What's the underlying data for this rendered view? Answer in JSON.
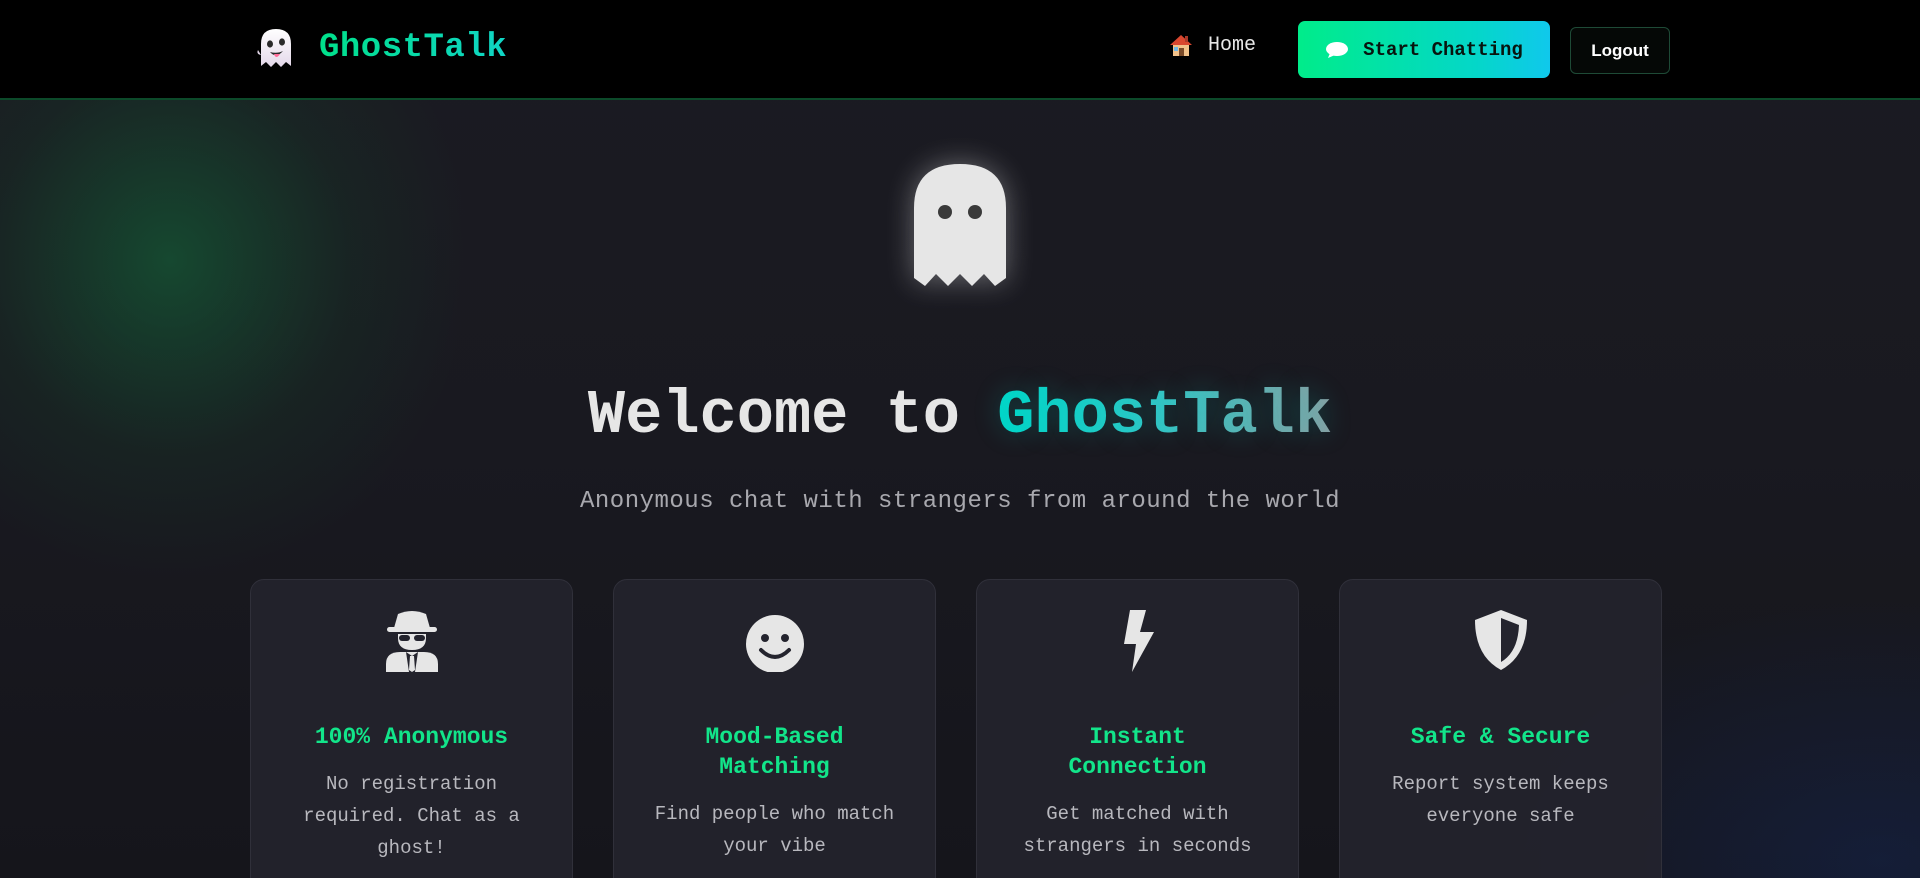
{
  "navbar": {
    "brand_name": "GhostTalk",
    "brand_icon": "ghost-emoji-icon",
    "home_label": "Home",
    "home_icon": "house-icon",
    "start_label": "Start Chatting",
    "start_icon": "speech-bubble-icon",
    "logout_label": "Logout"
  },
  "hero": {
    "icon": "ghost-icon",
    "title_prefix": "Welcome to",
    "title_accent": "GhostTalk",
    "subtitle": "Anonymous chat with strangers from around the world"
  },
  "features": [
    {
      "icon": "spy-icon",
      "title": "100% Anonymous",
      "description": "No registration required. Chat as a ghost!"
    },
    {
      "icon": "smiley-icon",
      "title": "Mood-Based Matching",
      "description": "Find people who match your vibe"
    },
    {
      "icon": "lightning-bolt-icon",
      "title": "Instant Connection",
      "description": "Get matched with strangers in seconds"
    },
    {
      "icon": "shield-icon",
      "title": "Safe & Secure",
      "description": "Report system keeps everyone safe"
    }
  ],
  "colors": {
    "accent_green": "#12e58a",
    "accent_cyan": "#04d7c8",
    "background": "#16161c",
    "navbar": "#000000"
  }
}
